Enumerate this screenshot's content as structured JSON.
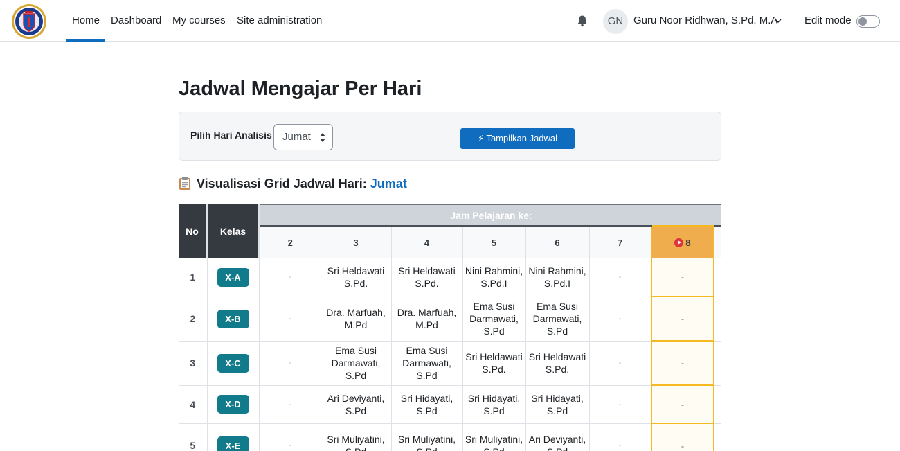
{
  "nav": {
    "items": [
      {
        "label": "Home",
        "active": true
      },
      {
        "label": "Dashboard",
        "active": false
      },
      {
        "label": "My courses",
        "active": false
      },
      {
        "label": "Site administration",
        "active": false
      }
    ],
    "user_initials": "GN",
    "user_name": "Guru Noor Ridhwan, S.Pd, M.A",
    "edit_mode_label": "Edit mode",
    "edit_mode_on": false,
    "icons": {
      "bell": "bell-icon",
      "chevron": "chevron-down-icon",
      "logo": "school-logo"
    }
  },
  "page": {
    "title": "Jadwal Mengajar Per Hari",
    "filter_label": "Pilih Hari Analisis",
    "day_selected": "Jumat",
    "show_button": "⚡ Tampilkan Jadwal",
    "section_prefix": "Visualisasi Grid Jadwal Hari:",
    "section_day": "Jumat"
  },
  "grid": {
    "col_no": "No",
    "col_kelas": "Kelas",
    "jam_header": "Jam Pelajaran ke:",
    "periods": [
      "2",
      "3",
      "4",
      "5",
      "6",
      "7",
      "8"
    ],
    "current_period": "8",
    "rows": [
      {
        "no": "1",
        "kelas": "X-A",
        "cells": [
          "-",
          "Sri Heldawati S.Pd.",
          "Sri Heldawati S.Pd.",
          "Nini Rahmini, S.Pd.I",
          "Nini Rahmini, S.Pd.I",
          "-",
          "-"
        ]
      },
      {
        "no": "2",
        "kelas": "X-B",
        "cells": [
          "-",
          "Dra. Marfuah, M.Pd",
          "Dra. Marfuah, M.Pd",
          "Ema Susi Darmawati, S.Pd",
          "Ema Susi Darmawati, S.Pd",
          "-",
          "-"
        ]
      },
      {
        "no": "3",
        "kelas": "X-C",
        "cells": [
          "-",
          "Ema Susi Darmawati, S.Pd",
          "Ema Susi Darmawati, S.Pd",
          "Sri Heldawati S.Pd.",
          "Sri Heldawati S.Pd.",
          "-",
          "-"
        ]
      },
      {
        "no": "4",
        "kelas": "X-D",
        "cells": [
          "-",
          "Ari Deviyanti, S.Pd",
          "Sri Hidayati, S.Pd",
          "Sri Hidayati, S.Pd",
          "Sri Hidayati, S.Pd",
          "-",
          "-"
        ]
      },
      {
        "no": "5",
        "kelas": "X-E",
        "cells": [
          "-",
          "Sri Muliyatini, S.Pd",
          "Sri Muliyatini, S.Pd",
          "Sri Muliyatini, S.Pd",
          "Ari Deviyanti, S.Pd",
          "-",
          "-"
        ]
      }
    ]
  }
}
